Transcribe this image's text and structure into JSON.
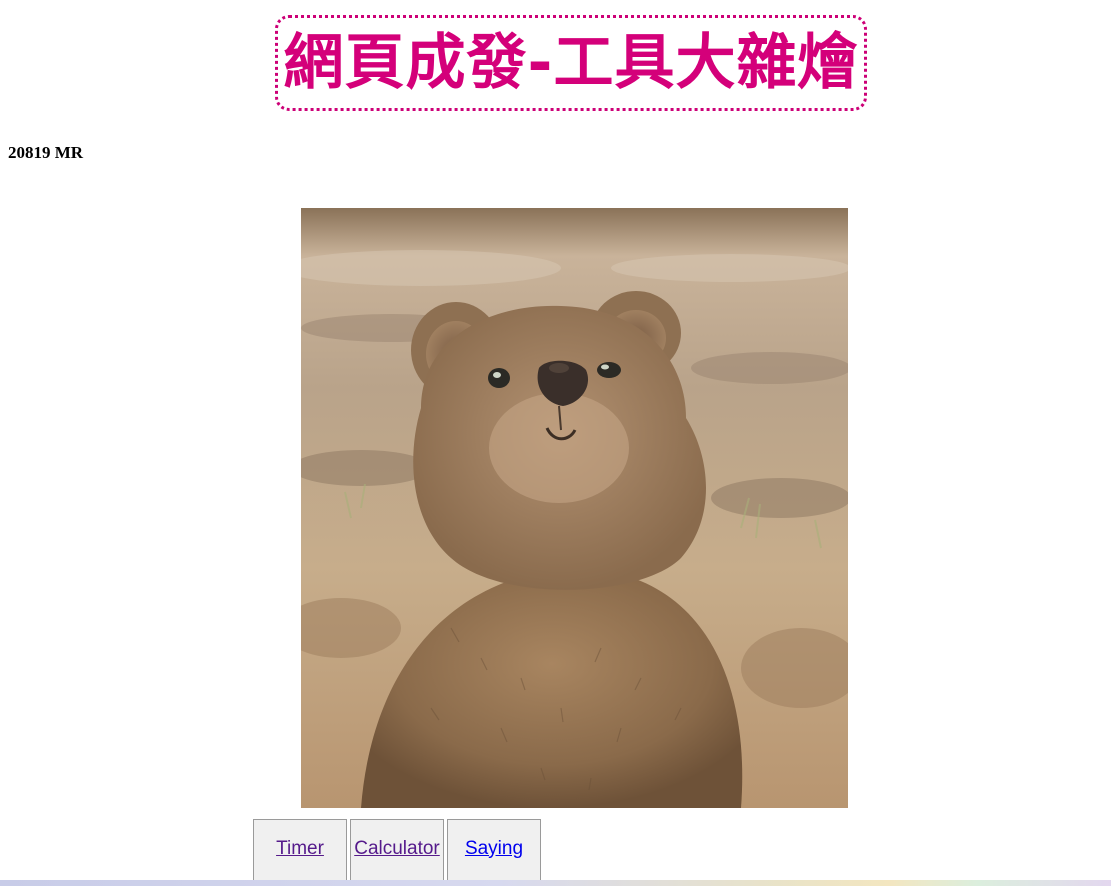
{
  "header": {
    "title": "網頁成發-工具大雜燴",
    "title_color": "#d4007a",
    "border_color": "#cc0077"
  },
  "counter_text": "20819 MR",
  "photo": {
    "subject": "quokka-photo"
  },
  "nav": {
    "items": [
      {
        "label": "Timer",
        "state": "visited"
      },
      {
        "label": "Calculator",
        "state": "visited"
      },
      {
        "label": "Saying",
        "state": "unvisited"
      }
    ],
    "visited_color": "#551a8b",
    "link_color": "#0000ee"
  }
}
